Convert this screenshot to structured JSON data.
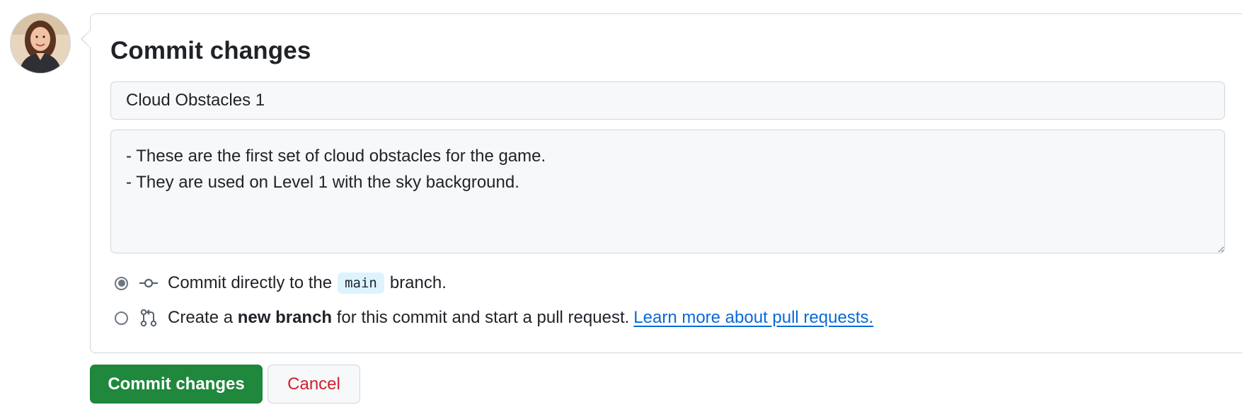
{
  "form": {
    "title": "Commit changes",
    "summary_value": "Cloud Obstacles 1",
    "description_value": "- These are the first set of cloud obstacles for the game.\n- They are used on Level 1 with the sky background."
  },
  "options": {
    "direct": {
      "selected": true,
      "prefix": "Commit directly to the",
      "branch": "main",
      "suffix": "branch.",
      "icon": "git-commit-icon"
    },
    "new_branch": {
      "selected": false,
      "prefix": "Create a",
      "bold": "new branch",
      "suffix": "for this commit and start a pull request.",
      "link": "Learn more about pull requests.",
      "icon": "git-pull-request-icon"
    }
  },
  "buttons": {
    "commit_label": "Commit changes",
    "cancel_label": "Cancel"
  },
  "colors": {
    "primary_green": "#1f883d",
    "danger_red": "#cf222e",
    "link_blue": "#0969da",
    "branch_bg": "#ddf4ff"
  }
}
